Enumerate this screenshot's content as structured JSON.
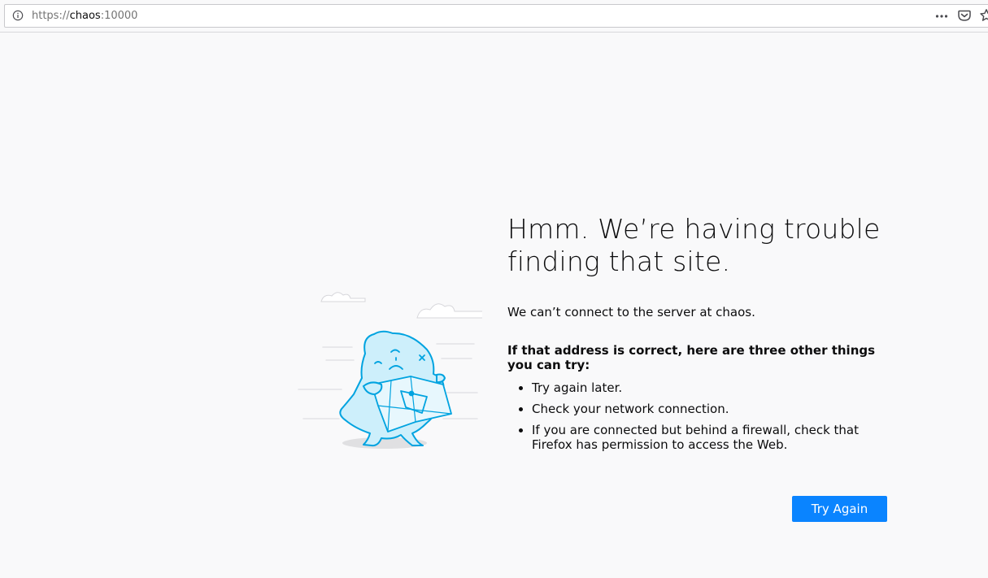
{
  "urlbar": {
    "scheme": "https://",
    "host": "chaos",
    "port": ":10000",
    "icons": [
      "info-icon",
      "page-actions-icon",
      "pocket-icon",
      "bookmark-icon"
    ]
  },
  "error": {
    "title": "Hmm. We’re having trouble finding that site.",
    "description": "We can’t connect to the server at chaos.",
    "subheading": "If that address is correct, here are three other things you can try:",
    "tips": [
      "Try again later.",
      "Check your network connection.",
      "If you are connected but behind a firewall, check that Firefox has permission to access the Web."
    ],
    "button_label": "Try Again"
  },
  "colors": {
    "page_background": "#f9f9fa",
    "accent": "#0a84ff",
    "illustration_stroke": "#00a3e0",
    "illustration_fill": "#cdeffb"
  }
}
